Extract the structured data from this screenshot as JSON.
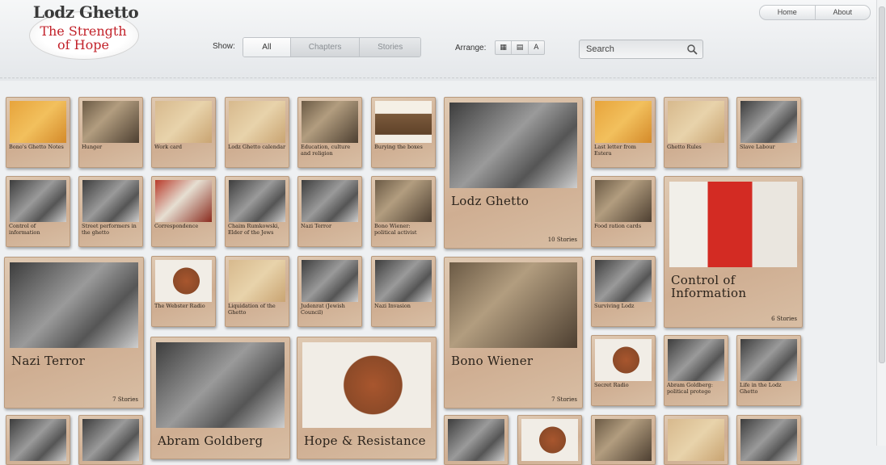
{
  "logo": {
    "title": "Lodz Ghetto",
    "subtitle_line1": "The Strength",
    "subtitle_line2": "of Hope"
  },
  "topnav": {
    "home": "Home",
    "about": "About"
  },
  "filters": {
    "show_label": "Show:",
    "options": [
      "All",
      "Chapters",
      "Stories"
    ],
    "active": "All"
  },
  "arrange": {
    "label": "Arrange:",
    "buttons": [
      "grid-view-icon",
      "list-view-icon",
      "A"
    ]
  },
  "search": {
    "placeholder": "Search"
  },
  "cards": {
    "c1": "Bono's Ghetto Notes",
    "c2": "Hunger",
    "c3": "Work card",
    "c4": "Lodz Ghetto calendar",
    "c5": "Education, culture and religion",
    "c6": "Burying the boxes",
    "c7": "Last letter from Estera",
    "c8": "Ghetto Rules",
    "c9": "Slave Labour",
    "c10": "Control of information",
    "c11": "Street performers in the ghetto",
    "c12": "Correspondence",
    "c13": "Chaim Rumkowski, Elder of the Jews",
    "c14": "Nazi Terror",
    "c15": "Bono Wiener: political activist",
    "c16": "Food ration cards",
    "c17": "The Webster Radio",
    "c18": "Liquidation of the Ghetto",
    "c19": "Judenrat (Jewish Council)",
    "c20": "Nazi Invasion",
    "c21": "Surviving Lodz",
    "c22": "Secret Radio",
    "c23": "Abram Goldberg: political protege",
    "c24": "Life in the Lodz Ghetto"
  },
  "chapters": {
    "lodz": {
      "title": "Lodz Ghetto",
      "count": "10 Stories"
    },
    "control": {
      "title": "Control of Information",
      "count": "6 Stories"
    },
    "nazi": {
      "title": "Nazi Terror",
      "count": "7 Stories"
    },
    "bono": {
      "title": "Bono Wiener",
      "count": "7 Stories"
    },
    "abram": {
      "title": "Abram Goldberg"
    },
    "hope": {
      "title": "Hope & Resistance"
    }
  }
}
